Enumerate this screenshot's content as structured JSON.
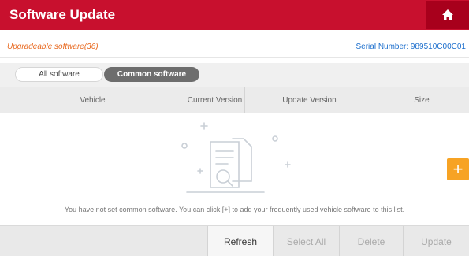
{
  "header": {
    "title": "Software Update",
    "home_icon": "home-icon",
    "brand_color": "#c8102e"
  },
  "info": {
    "upgradeable": "Upgradeable software(36)",
    "serial": "Serial Number: 989510C00C01"
  },
  "tabs": [
    {
      "label": "All software",
      "selected": false
    },
    {
      "label": "Common software",
      "selected": true
    }
  ],
  "table": {
    "columns": [
      "Vehicle",
      "Current Version",
      "Update Version",
      "Size"
    ]
  },
  "empty_state": {
    "icon": "empty-document-search-icon",
    "message": "You have not set common software. You can click [+] to add your frequently used vehicle software to this list."
  },
  "fab": {
    "label": "+",
    "icon": "plus-icon",
    "color": "#f7a324"
  },
  "actions": {
    "refresh": "Refresh",
    "select_all": "Select All",
    "delete": "Delete",
    "update": "Update"
  }
}
